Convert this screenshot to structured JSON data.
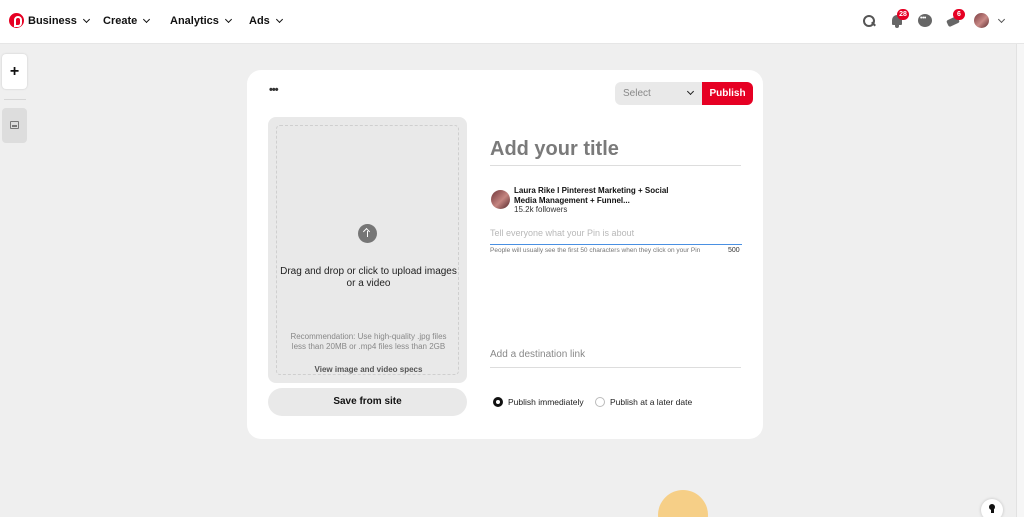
{
  "nav": {
    "items": [
      {
        "label": "Business"
      },
      {
        "label": "Create"
      },
      {
        "label": "Analytics"
      },
      {
        "label": "Ads"
      }
    ],
    "notifications_count": "28",
    "updates_count": "6"
  },
  "toolbar": {
    "more_label": "•••",
    "board_select_label": "Select",
    "publish_label": "Publish"
  },
  "upload": {
    "instruction": "Drag and drop or click to upload images or a video",
    "recommendation": "Recommendation: Use high-quality .jpg files less than 20MB or .mp4 files less than 2GB",
    "specs_link": "View image and video specs",
    "save_from_site_label": "Save from site"
  },
  "form": {
    "title_placeholder": "Add your title",
    "author_name": "Laura Rike I Pinterest Marketing + Social Media Management + Funnel...",
    "author_followers": "15.2k followers",
    "description_placeholder": "Tell everyone what your Pin is about",
    "description_help": "People will usually see the first 50 characters when they click on your Pin",
    "description_char_count": "500",
    "link_placeholder": "Add a destination link",
    "publish_immediately_label": "Publish immediately",
    "publish_later_label": "Publish at a later date"
  },
  "rail": {
    "add_label": "+"
  },
  "colors": {
    "brand": "#e60023",
    "focus": "#4a90e2"
  }
}
